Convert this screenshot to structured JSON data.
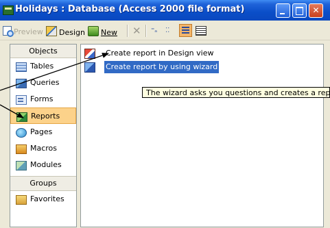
{
  "window": {
    "title": "Holidays : Database (Access 2000 file format)",
    "buttons": {
      "minimize": "minimize",
      "maximize": "maximize",
      "close": "close"
    }
  },
  "toolbar": {
    "preview_label": "Preview",
    "design_label": "Design",
    "new_label": "New",
    "delete_icon": "delete-icon",
    "large_icons": "large-icons-icon",
    "small_icons": "small-icons-icon",
    "list_view": "list-icon",
    "details_view": "details-icon"
  },
  "objects_panel": {
    "header": "Objects",
    "items": [
      {
        "label": "Tables",
        "icon": "table-icon"
      },
      {
        "label": "Queries",
        "icon": "query-icon"
      },
      {
        "label": "Forms",
        "icon": "form-icon"
      },
      {
        "label": "Reports",
        "icon": "report-icon",
        "active": true
      },
      {
        "label": "Pages",
        "icon": "page-icon"
      },
      {
        "label": "Macros",
        "icon": "macro-icon"
      },
      {
        "label": "Modules",
        "icon": "module-icon"
      }
    ],
    "groups_header": "Groups",
    "groups": [
      {
        "label": "Favorites",
        "icon": "favorites-folder-icon"
      }
    ]
  },
  "list_panel": {
    "items": [
      {
        "label": "Create report in Design view",
        "icon": "design-view-icon"
      },
      {
        "label": "Create report by using wizard",
        "icon": "wizard-icon",
        "selected": true
      }
    ],
    "tooltip": "The wizard asks you questions and creates a report bas"
  },
  "colors": {
    "titlebar": "#0a4ec8",
    "selection": "#316ac5",
    "active_object": "#fcd28a",
    "tooltip_bg": "#ffffe1",
    "window_bg": "#ece9d8"
  }
}
